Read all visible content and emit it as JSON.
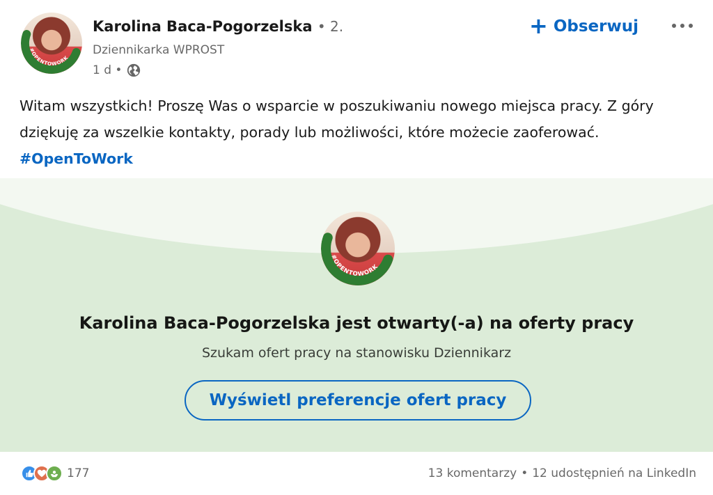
{
  "post": {
    "author_name": "Karolina Baca-Pogorzelska",
    "connection_degree": "• 2.",
    "headline": "Dziennikarka WPROST",
    "time_ago": "1 d •",
    "follow_label": "Obserwuj",
    "text_main": "Witam wszystkich! Proszę Was o wsparcie w poszukiwaniu nowego miejsca pracy. Z góry dziękuję za wszelkie kontakty, porady lub możliwości, które możecie zaoferować. ",
    "hashtag": "#OpenToWork",
    "avatar_badge": "#OPENTOWORK"
  },
  "banner": {
    "title": "Karolina Baca-Pogorzelska jest otwarty(-a) na oferty pracy",
    "subtitle": "Szukam ofert pracy na stanowisku Dziennikarz",
    "button_label": "Wyświetl preferencje ofert pracy",
    "badge": "#OPENTOWORK"
  },
  "social": {
    "reaction_count": "177",
    "comments": "13 komentarzy",
    "separator": "•",
    "shares": "12 udostępnień na LinkedIn",
    "reaction_icons": [
      "like-icon",
      "love-icon",
      "support-icon"
    ]
  },
  "colors": {
    "accent": "#0a66c2",
    "otw_green": "#2e7d32",
    "banner_bg": "#dcecd8"
  }
}
